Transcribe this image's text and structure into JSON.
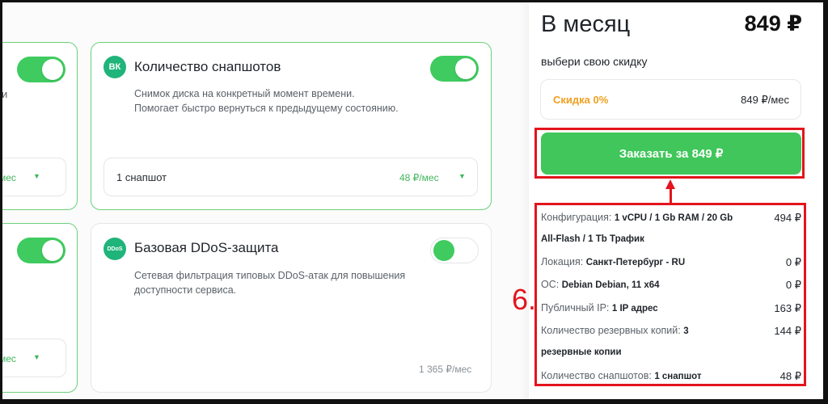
{
  "cards": {
    "snapshots": {
      "badge": "ВК",
      "title": "Количество снапшотов",
      "desc_line1": "Снимок диска на конкретный момент времени.",
      "desc_line2": "Помогает быстро вернуться к предыдущему состоянию.",
      "select_value": "1 снапшот",
      "select_price": "48 ₽/мес",
      "toggle_on": true
    },
    "ddos": {
      "badge": "DDoS",
      "title": "Базовая DDoS-защита",
      "desc_line1": "Сетевая фильтрация типовых DDoS-атак для повышения",
      "desc_line2": "доступности сервиса.",
      "price": "1 365 ₽/мес",
      "toggle_on": false
    },
    "left_top": {
      "frag_text": "и",
      "price": "₽/мес"
    },
    "left_bottom": {
      "price": "₽/мес"
    }
  },
  "summary": {
    "title": "В месяц",
    "total": "849 ₽",
    "discount_prompt": "выбери свою скидку",
    "discount_label": "Скидка 0%",
    "discount_price": "849 ₽/мес",
    "order_button": "Заказать за 849 ₽",
    "rows": [
      {
        "label": "Конфигурация: ",
        "value": "1 vCPU / 1 Gb RAM / 20 Gb",
        "price": "494 ₽"
      },
      {
        "label": "",
        "value": "All-Flash / 1 Tb Трафик",
        "price": ""
      },
      {
        "label": "Локация: ",
        "value": "Санкт-Петербург - RU",
        "price": "0 ₽"
      },
      {
        "label": "ОС: ",
        "value": "Debian Debian, 11 x64",
        "price": "0 ₽"
      },
      {
        "label": "Публичный IP: ",
        "value": "1 IP адрес",
        "price": "163 ₽"
      },
      {
        "label": "Количество резервных копий: ",
        "value": "3",
        "price": "144 ₽"
      },
      {
        "label": "",
        "value": "резервные копии",
        "price": ""
      },
      {
        "label": "Количество снапшотов: ",
        "value": "1 снапшот",
        "price": "48 ₽"
      }
    ]
  },
  "annotation": {
    "step": "6."
  },
  "colors": {
    "accent_green": "#40c65a",
    "annotation_red": "#e3141c",
    "discount_orange": "#f0a020"
  }
}
